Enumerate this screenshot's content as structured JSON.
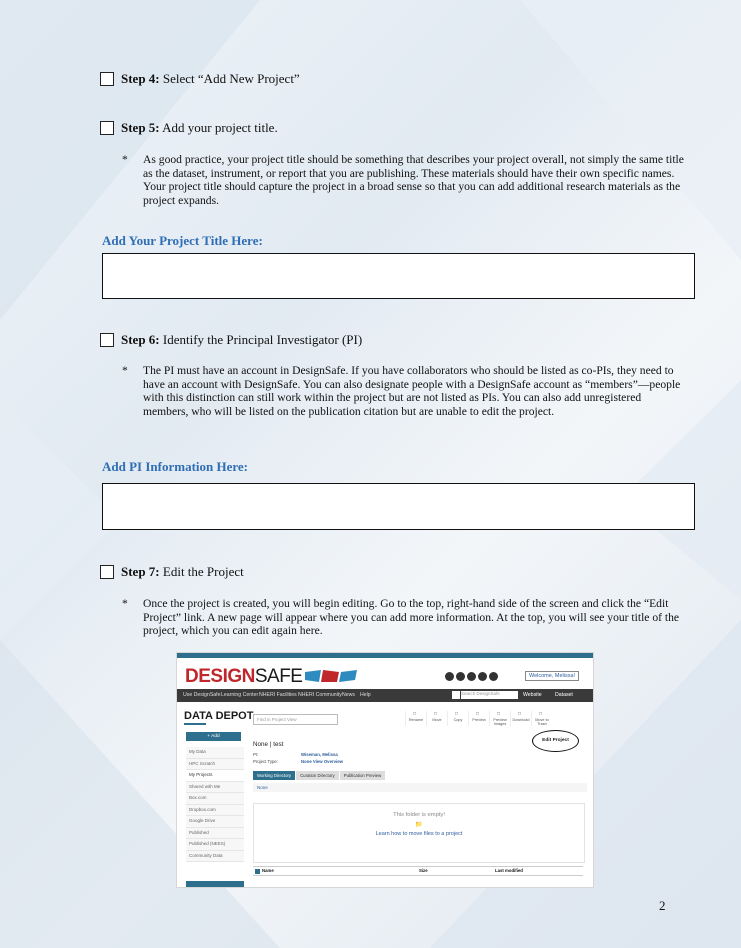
{
  "steps": {
    "s4": {
      "label": "Step 4:",
      "text": " Select “Add New Project”"
    },
    "s5": {
      "label": "Step 5:",
      "text": " Add your project title."
    },
    "s6": {
      "label": "Step 6:",
      "text": " Identify the Principal Investigator (PI)"
    },
    "s7": {
      "label": "Step 7:",
      "text": " Edit the Project"
    }
  },
  "bullets": {
    "b5": "As good practice, your project title should be something that describes your project overall, not simply the same title as the dataset, instrument, or report that you are publishing. These materials should have their own specific names. Your project title should capture the project in a broad sense so that you can add additional research materials as the project expands.",
    "b6": "The PI must have an account in DesignSafe. If you have collaborators who should be listed as co-PIs, they need to have an account with DesignSafe. You can also designate people with a DesignSafe account as “members”—people with this distinction can still work within the project but are not listed as PIs. You can also add unregistered members, who will be listed on the publication citation but are unable to edit the project.",
    "b7": "Once the project is created, you will begin editing. Go to the top, right-hand side of the screen and click the “Edit Project” link. A new page will appear where you can add more information. At the top, you will see your title of the project, which you can edit again here."
  },
  "bullet_marker": "*",
  "headings": {
    "title_here": "Add Your Project Title Here:",
    "pi_here": "Add PI Information Here:"
  },
  "page_number": "2",
  "screenshot": {
    "logo_a": "DESIGN",
    "logo_b": "SAFE",
    "welcome": "Welcome, Melissa!",
    "nav": [
      "Use DesignSafe",
      "Learning Center",
      "NHERI Facilities",
      "NHERI Community",
      "News",
      "Help"
    ],
    "search_placeholder": "Search DesignSafe",
    "website_label": "Website",
    "intranet_label": "Dataset",
    "depot_title": "DATA DEPOT",
    "find_placeholder": "Find in Project View",
    "toolbar": [
      "Rename",
      "Move",
      "Copy",
      "Preview",
      "Preview Images",
      "Download",
      "Move to Trash"
    ],
    "add_label": "+ Add",
    "sidebar": [
      "My Data",
      "HPC Scratch",
      "My Projects",
      "Shared with Me",
      "Box.com",
      "Dropbox.com",
      "Google Drive",
      "Published",
      "Published (NEES)",
      "Community Data"
    ],
    "crumb": "None | test",
    "pi_label": "PI:",
    "pi_value": "Wiseman, Melissa",
    "type_label": "Project Type:",
    "type_value": "None  View Overview",
    "edit_project": "Edit Project",
    "tabs": [
      "Working Directory",
      "Curation Directory",
      "Publication Preview"
    ],
    "path": "None",
    "empty_title": "This folder is empty!",
    "empty_link": "Learn how to move files to a project",
    "table_headers": [
      "Name",
      "Size",
      "Last modified"
    ]
  }
}
